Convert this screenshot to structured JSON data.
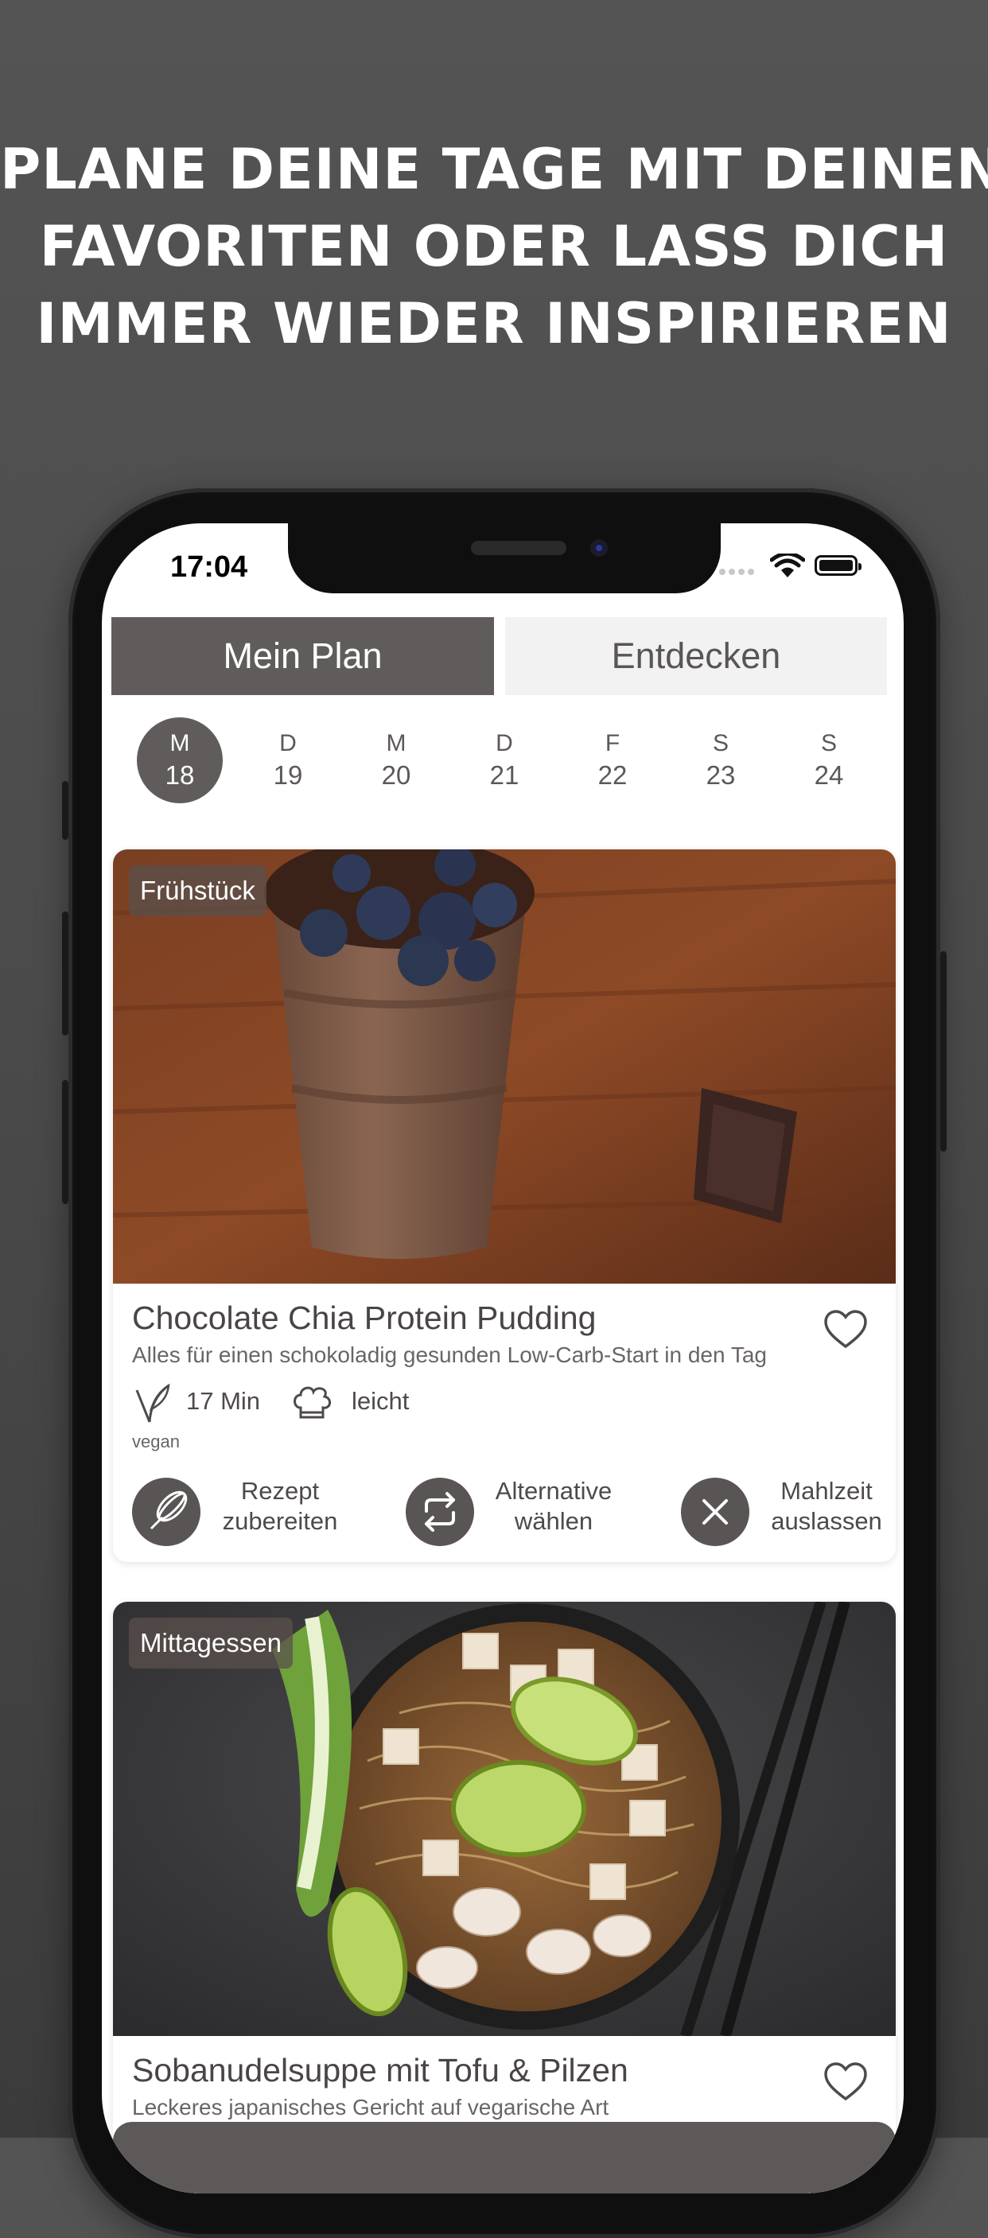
{
  "headline": {
    "line1": "PLANE DEINE TAGE MIT DEINEN",
    "line2": "FAVORITEN ODER LASS DICH",
    "line3": "IMMER WIEDER INSPIRIEREN"
  },
  "status_bar": {
    "time": "17:04"
  },
  "tabs": [
    {
      "label": "Mein Plan",
      "active": true
    },
    {
      "label": "Entdecken",
      "active": false
    }
  ],
  "days": [
    {
      "letter": "M",
      "number": "18",
      "selected": true
    },
    {
      "letter": "D",
      "number": "19"
    },
    {
      "letter": "M",
      "number": "20"
    },
    {
      "letter": "D",
      "number": "21"
    },
    {
      "letter": "F",
      "number": "22"
    },
    {
      "letter": "S",
      "number": "23"
    },
    {
      "letter": "S",
      "number": "24"
    }
  ],
  "meals": [
    {
      "category": "Frühstück",
      "title": "Chocolate Chia Protein Pudding",
      "subtitle": "Alles für einen schokoladig gesunden Low-Carb-Start in den Tag",
      "time": "17 Min",
      "difficulty": "leicht",
      "diet": "vegan",
      "actions": [
        {
          "line1": "Rezept",
          "line2": "zubereiten",
          "icon": "whisk-icon"
        },
        {
          "line1": "Alternative",
          "line2": "wählen",
          "icon": "swap-icon"
        },
        {
          "line1": "Mahlzeit",
          "line2": "auslassen",
          "icon": "close-icon"
        }
      ]
    },
    {
      "category": "Mittagessen",
      "title": "Sobanudelsuppe mit Tofu & Pilzen",
      "subtitle": "Leckeres japanisches Gericht auf vegarische Art"
    }
  ],
  "colors": {
    "accent": "#615c5c",
    "background": "#4b4b4b",
    "tab_inactive": "#f2f2f2"
  }
}
